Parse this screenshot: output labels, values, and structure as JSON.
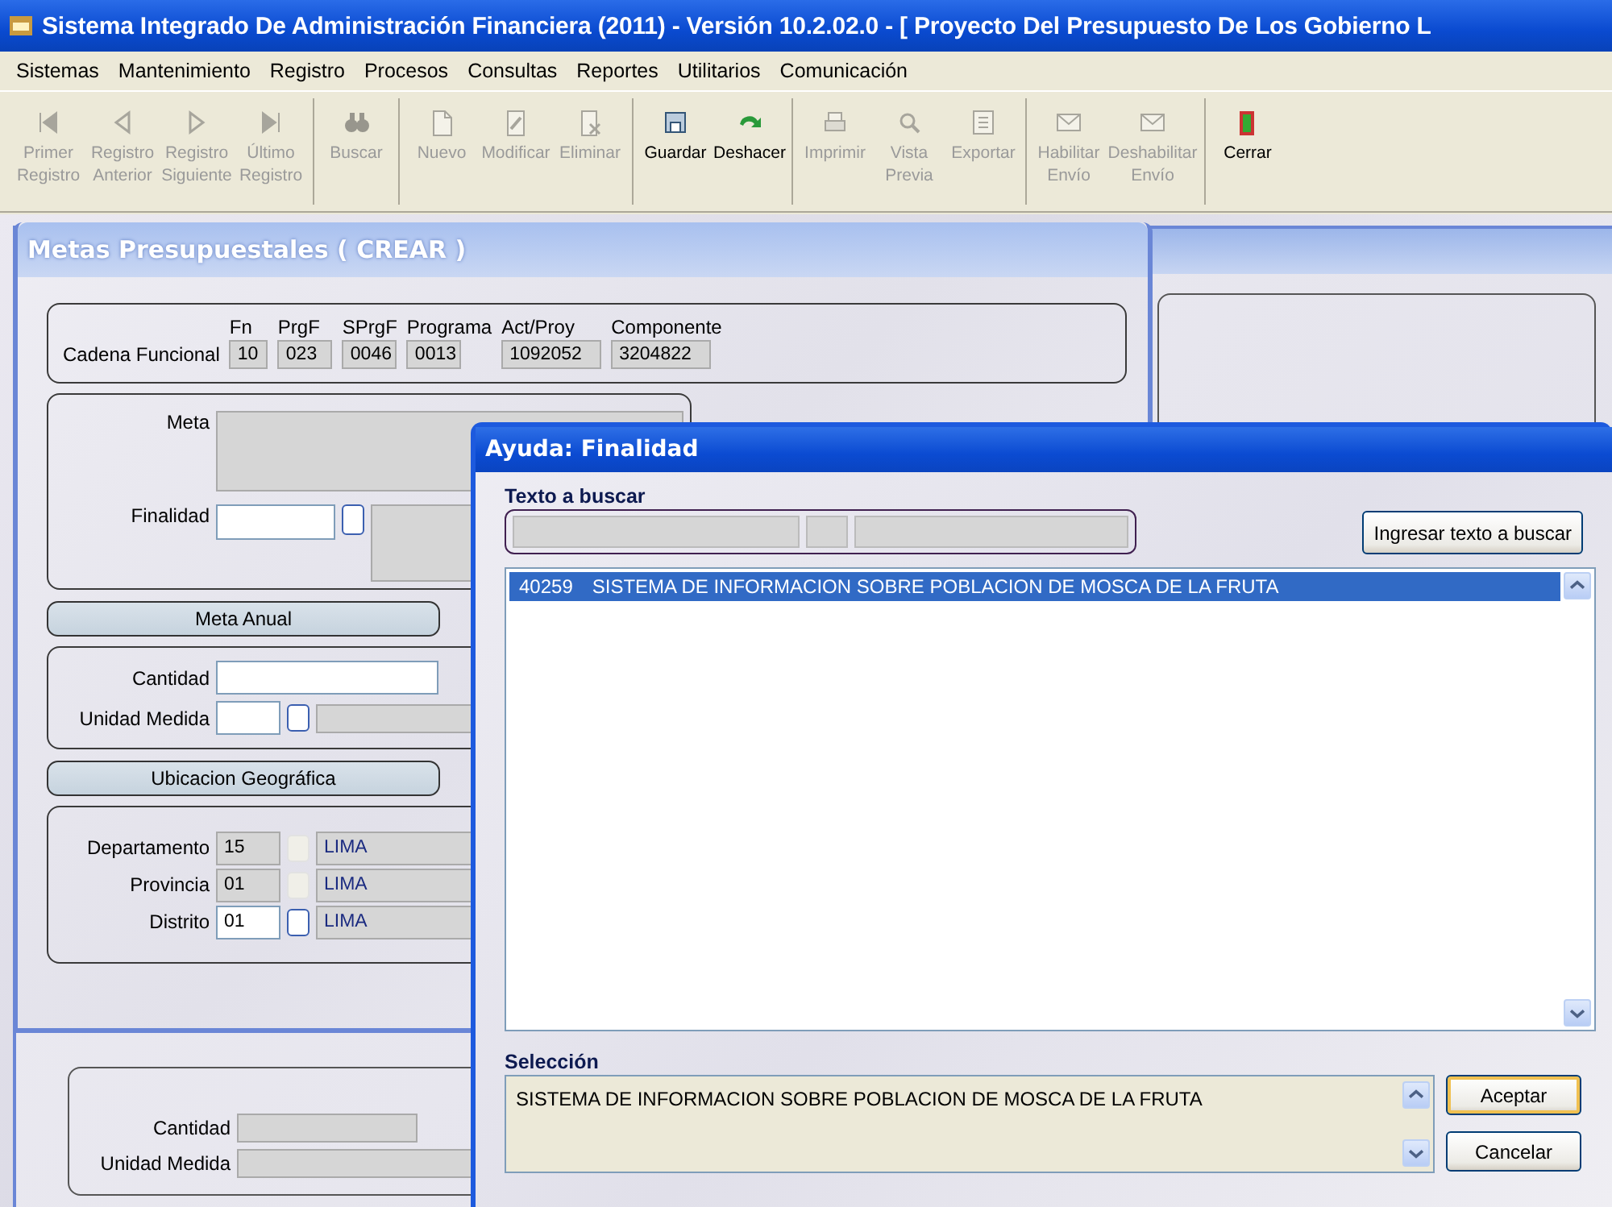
{
  "window": {
    "title": "Sistema Integrado De Administración Financiera (2011) - Versión 10.2.02.0 - [ Proyecto Del Presupuesto De Los Gobierno L"
  },
  "menu": [
    "Sistemas",
    "Mantenimiento",
    "Registro",
    "Procesos",
    "Consultas",
    "Reportes",
    "Utilitarios",
    "Comunicación"
  ],
  "toolbar": [
    [
      {
        "lines": [
          "Primer",
          "Registro"
        ],
        "disabled": true
      },
      {
        "lines": [
          "Registro",
          "Anterior"
        ],
        "disabled": true
      },
      {
        "lines": [
          "Registro",
          "Siguiente"
        ],
        "disabled": true
      },
      {
        "lines": [
          "Último",
          "Registro"
        ],
        "disabled": true
      }
    ],
    [
      {
        "lines": [
          "Buscar"
        ],
        "disabled": true
      }
    ],
    [
      {
        "lines": [
          "Nuevo"
        ],
        "disabled": true
      },
      {
        "lines": [
          "Modificar"
        ],
        "disabled": true
      },
      {
        "lines": [
          "Eliminar"
        ],
        "disabled": true
      }
    ],
    [
      {
        "lines": [
          "Guardar"
        ],
        "disabled": false
      },
      {
        "lines": [
          "Deshacer"
        ],
        "disabled": false
      }
    ],
    [
      {
        "lines": [
          "Imprimir"
        ],
        "disabled": true
      },
      {
        "lines": [
          "Vista",
          "Previa"
        ],
        "disabled": true
      },
      {
        "lines": [
          "Exportar"
        ],
        "disabled": true
      }
    ],
    [
      {
        "lines": [
          "Habilitar",
          "Envío"
        ],
        "disabled": true
      },
      {
        "lines": [
          "Deshabilitar",
          "Envío"
        ],
        "disabled": true
      }
    ],
    [
      {
        "lines": [
          "Cerrar"
        ],
        "disabled": false
      }
    ]
  ],
  "metas_window": {
    "title": "Metas Presupuestales ( CREAR )",
    "cadena": {
      "label": "Cadena Funcional",
      "columns": [
        {
          "header": "Fn",
          "value": "10"
        },
        {
          "header": "PrgF",
          "value": "023"
        },
        {
          "header": "SPrgF",
          "value": "0046"
        },
        {
          "header": "Programa",
          "value": "0013"
        },
        {
          "header": "Act/Proy",
          "value": "1092052"
        },
        {
          "header": "Componente",
          "value": "3204822"
        }
      ]
    },
    "meta": {
      "label": "Meta"
    },
    "finalidad": {
      "label": "Finalidad"
    },
    "meta_anual": {
      "heading": "Meta Anual",
      "cantidad": {
        "label": "Cantidad"
      },
      "unidad": {
        "label": "Unidad Medida"
      }
    },
    "ubicacion": {
      "heading": "Ubicacion Geográfica",
      "rows": [
        {
          "label": "Departamento",
          "code": "15",
          "name": "LIMA",
          "disabled": true
        },
        {
          "label": "Provincia",
          "code": "01",
          "name": "LIMA",
          "disabled": true
        },
        {
          "label": "Distrito",
          "code": "01",
          "name": "LIMA",
          "disabled": false
        }
      ]
    }
  },
  "back_form": {
    "fields": [
      {
        "label": "Cantidad"
      },
      {
        "label": "Unidad Medida"
      }
    ]
  },
  "dialog": {
    "title": "Ayuda: Finalidad",
    "search_label": "Texto a buscar",
    "search_button": "Ingresar texto a buscar",
    "results": [
      {
        "code": "40259",
        "text": "SISTEMA DE INFORMACION SOBRE POBLACION DE MOSCA DE LA FRUTA",
        "selected": true
      }
    ],
    "selection_label": "Selección",
    "selection": "SISTEMA DE INFORMACION SOBRE POBLACION DE MOSCA DE LA FRUTA",
    "buttons": [
      "Aceptar",
      "Cancelar"
    ]
  }
}
